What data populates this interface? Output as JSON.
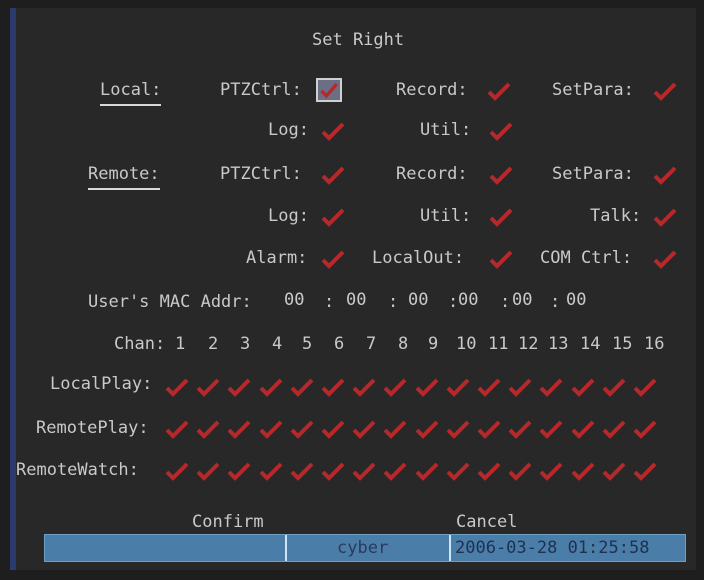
{
  "title": "Set Right",
  "local": {
    "label": "Local:",
    "ptz": "PTZCtrl:",
    "record": "Record:",
    "setpara": "SetPara:",
    "log": "Log:",
    "util": "Util:"
  },
  "remote": {
    "label": "Remote:",
    "ptz": "PTZCtrl:",
    "record": "Record:",
    "setpara": "SetPara:",
    "log": "Log:",
    "util": "Util:",
    "talk": "Talk:",
    "alarm": "Alarm:",
    "localout": "LocalOut:",
    "comctrl": "COM Ctrl:"
  },
  "mac": {
    "label": "User's MAC Addr:",
    "octets": [
      "00",
      "00",
      "00",
      "00",
      "00",
      "00"
    ]
  },
  "channels": {
    "label": "Chan:",
    "numbers": [
      "1",
      "2",
      "3",
      "4",
      "5",
      "6",
      "7",
      "8",
      "9",
      "10",
      "11",
      "12",
      "13",
      "14",
      "15",
      "16"
    ]
  },
  "rows": {
    "localplay": "LocalPlay:",
    "remoteplay": "RemotePlay:",
    "remotewatch": "RemoteWatch:"
  },
  "buttons": {
    "confirm": "Confirm",
    "cancel": "Cancel"
  },
  "status": {
    "user": "cyber",
    "datetime": "2006-03-28 01:25:58"
  },
  "colors": {
    "check": "#b8282a",
    "status_bar": "#4a7ea8"
  },
  "icons": {
    "check": "check-icon"
  }
}
